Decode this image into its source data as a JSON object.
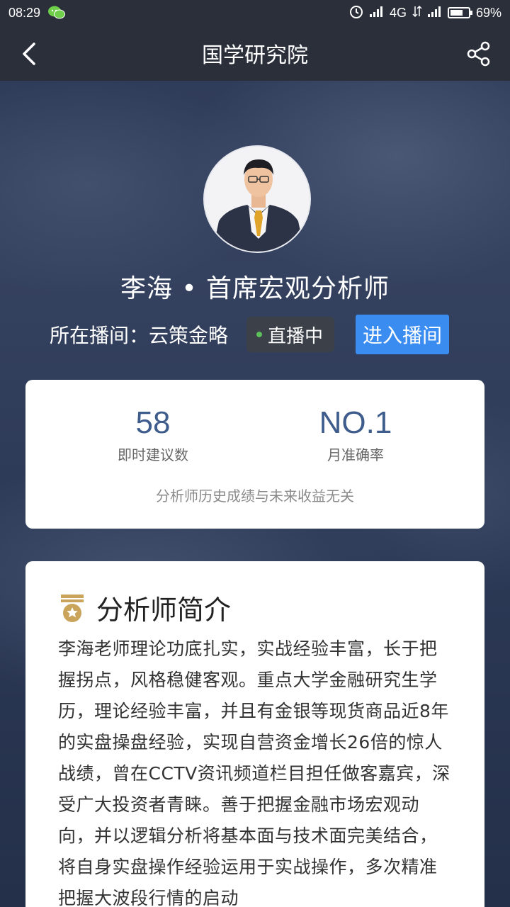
{
  "status_bar": {
    "time": "08:29",
    "network": "4G",
    "battery_percent": "69%",
    "battery_level": 0.69
  },
  "nav": {
    "title": "国学研究院",
    "back_icon": "chevron-left-icon",
    "share_icon": "share-icon"
  },
  "profile": {
    "name_title": "李海 • 首席宏观分析师",
    "room_label": "所在播间：云策金略",
    "live_status": "直播中",
    "enter_button": "进入播间"
  },
  "stats": {
    "advice_count": "58",
    "advice_label": "即时建议数",
    "rank": "NO.1",
    "rank_label": "月准确率",
    "disclaimer": "分析师历史成绩与未来收益无关"
  },
  "intro": {
    "title": "分析师简介",
    "text": "李海老师理论功底扎实，实战经验丰富，长于把握拐点，风格稳健客观。重点大学金融研究生学历，理论经验丰富，并且有金银等现货商品近8年的实盘操盘经验，实现自营资金增长26倍的惊人战绩，曾在CCTV资讯频道栏目担任做客嘉宾，深受广大投资者青睐。善于把握金融市场宏观动向，并以逻辑分析将基本面与技术面完美结合，将自身实盘操作经验运用于实战操作，多次精准把握大波段行情的启动"
  },
  "colors": {
    "accent_blue": "#3a8cf0",
    "stat_value": "#3f5d8c",
    "live_green": "#5bc05a",
    "medal_gold": "#c9a45a"
  }
}
